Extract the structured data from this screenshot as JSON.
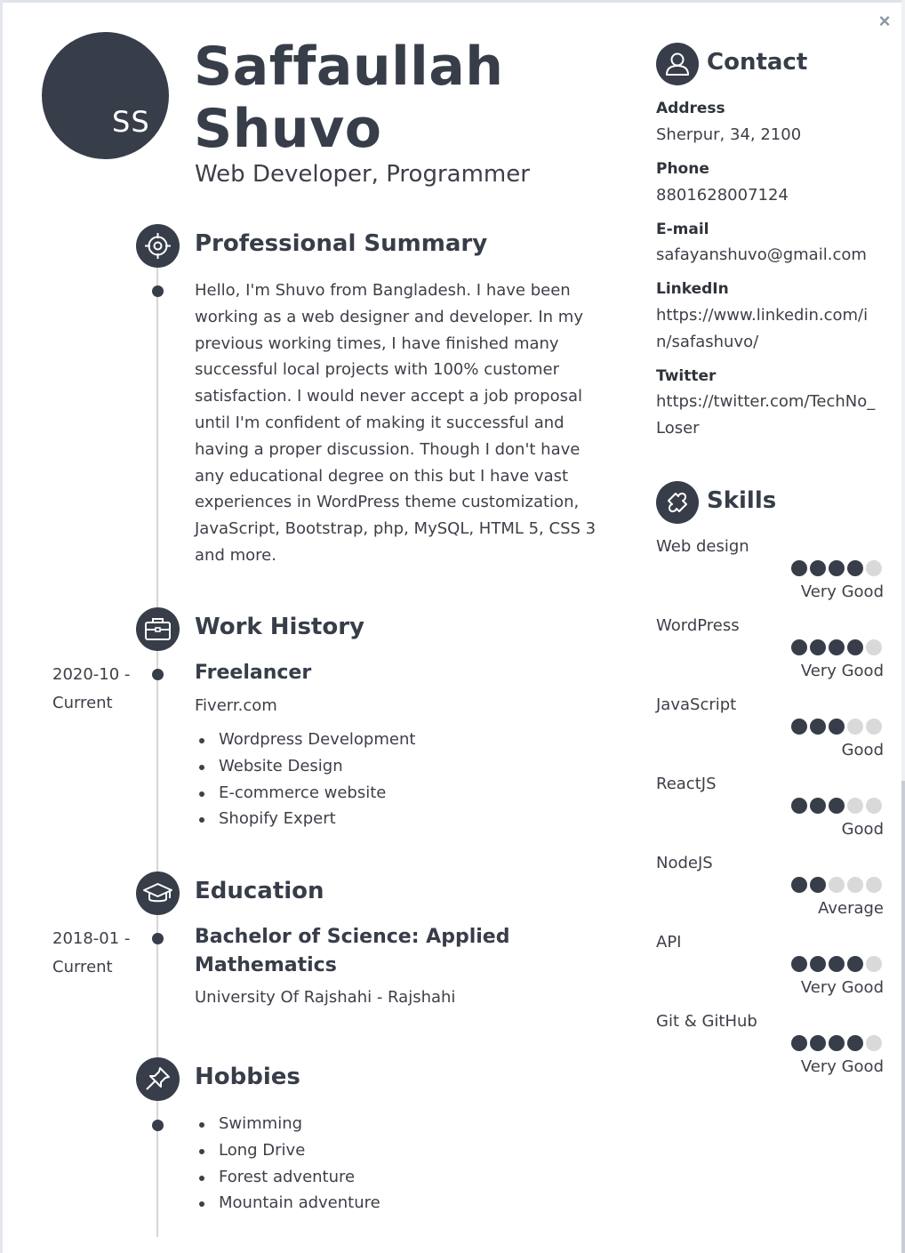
{
  "close_label": "×",
  "header": {
    "initials": "SS",
    "first_name": "Saffaullah",
    "last_name": "Shuvo",
    "job_title": "Web Developer, Programmer"
  },
  "summary": {
    "title": "Professional Summary",
    "text": "Hello, I'm Shuvo from Bangladesh. I have been working as a web designer and developer. In my previous working times, I have finished many successful local projects with 100% customer satisfaction. I would never accept a job proposal until I'm confident of making it successful and having a proper discussion. Though I don't have any educational degree on this but I have vast experiences in WordPress theme customization, JavaScript, Bootstrap, php, MySQL, HTML 5, CSS 3 and more."
  },
  "work": {
    "title": "Work History",
    "entries": [
      {
        "date_start": "2020-10 -",
        "date_end": "Current",
        "position": "Freelancer",
        "company": "Fiverr.com",
        "bullets": [
          "Wordpress Development",
          "Website Design",
          "E-commerce website",
          "Shopify Expert"
        ]
      }
    ]
  },
  "education": {
    "title": "Education",
    "entries": [
      {
        "date_start": "2018-01 -",
        "date_end": "Current",
        "degree_line1": "Bachelor of Science: Applied",
        "degree_line2": "Mathematics",
        "school": "University Of Rajshahi - Rajshahi"
      }
    ]
  },
  "hobbies": {
    "title": "Hobbies",
    "items": [
      "Swimming",
      "Long Drive",
      "Forest adventure",
      "Mountain adventure"
    ]
  },
  "contact": {
    "title": "Contact",
    "address_label": "Address",
    "address": "Sherpur, 34, 2100",
    "phone_label": "Phone",
    "phone": "8801628007124",
    "email_label": "E-mail",
    "email": "safayanshuvo@gmail.com",
    "linkedin_label": "LinkedIn",
    "linkedin": "https://www.linkedin.com/in/safashuvo/",
    "twitter_label": "Twitter",
    "twitter": "https://twitter.com/TechNo_Loser"
  },
  "skills": {
    "title": "Skills",
    "max_rating": 5,
    "items": [
      {
        "name": "Web design",
        "rating": 4,
        "level": "Very Good"
      },
      {
        "name": "WordPress",
        "rating": 4,
        "level": "Very Good"
      },
      {
        "name": "JavaScript",
        "rating": 3,
        "level": "Good"
      },
      {
        "name": "ReactJS",
        "rating": 3,
        "level": "Good"
      },
      {
        "name": "NodeJS",
        "rating": 2,
        "level": "Average"
      },
      {
        "name": "API",
        "rating": 4,
        "level": "Very Good"
      },
      {
        "name": "Git & GitHub",
        "rating": 4,
        "level": "Very Good"
      }
    ]
  },
  "colors": {
    "primary": "#373d49",
    "dot_off": "#d9d9d9",
    "text": "#3d4048"
  }
}
